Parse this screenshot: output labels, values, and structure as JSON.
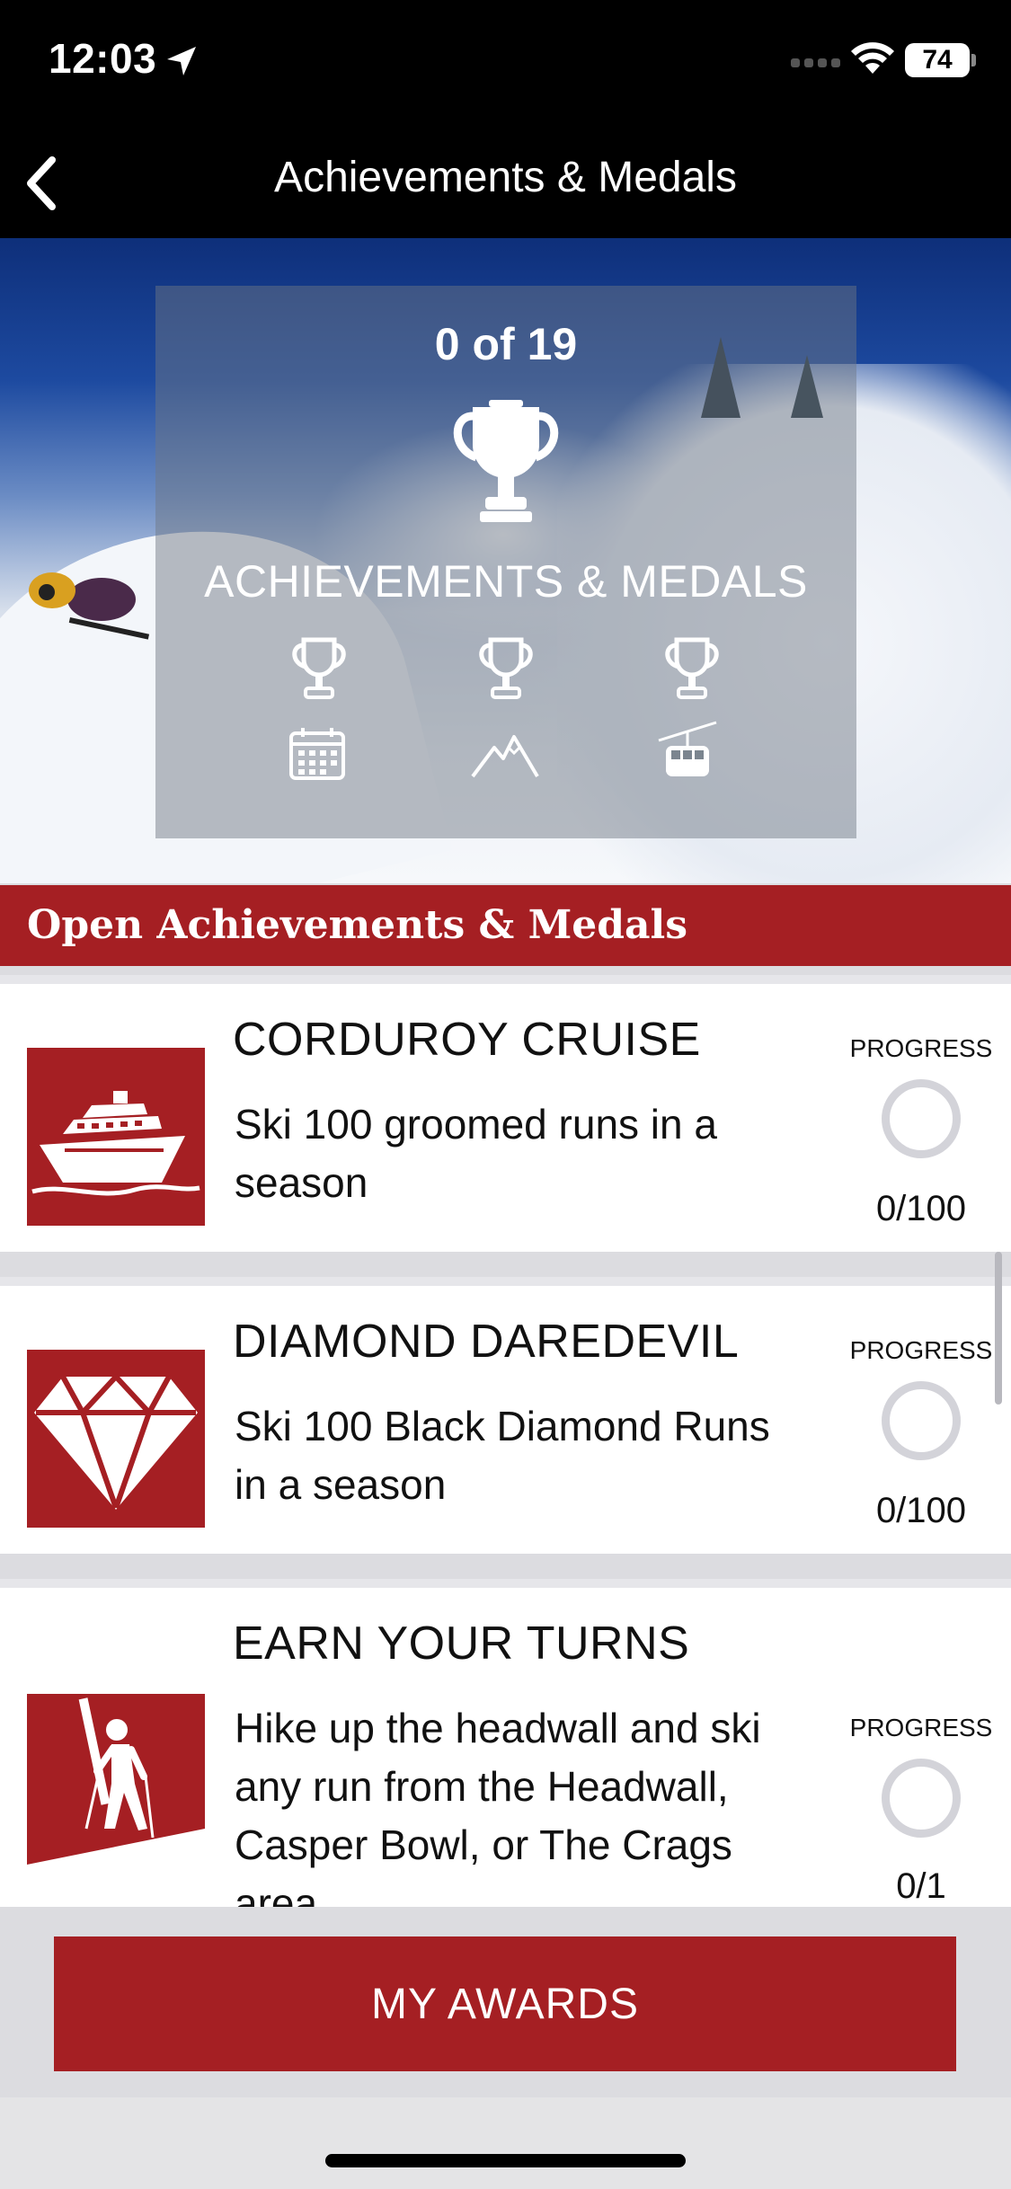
{
  "status_bar": {
    "time": "12:03",
    "battery": "74"
  },
  "nav": {
    "title": "Achievements & Medals"
  },
  "hero": {
    "count": "0 of 19",
    "heading": "ACHIEVEMENTS & MEDALS"
  },
  "section": {
    "title": "Open Achievements & Medals"
  },
  "achievements": [
    {
      "title": "CORDUROY CRUISE",
      "description": "Ski 100 groomed runs in a season",
      "progress_label": "PROGRESS",
      "progress": "0/100",
      "icon": "cruise-ship-icon"
    },
    {
      "title": "DIAMOND DAREDEVIL",
      "description": "Ski 100 Black Diamond Runs in a season",
      "progress_label": "PROGRESS",
      "progress": "0/100",
      "icon": "diamond-icon"
    },
    {
      "title": "EARN YOUR TURNS",
      "description": "Hike up the headwall and ski any run from the Headwall, Casper Bowl, or The Crags area",
      "progress_label": "PROGRESS",
      "progress": "0/1",
      "icon": "hiker-icon"
    }
  ],
  "bottom": {
    "button_label": "MY AWARDS"
  },
  "colors": {
    "accent": "#a51f23",
    "background": "#dcdce0",
    "header": "#000000"
  }
}
